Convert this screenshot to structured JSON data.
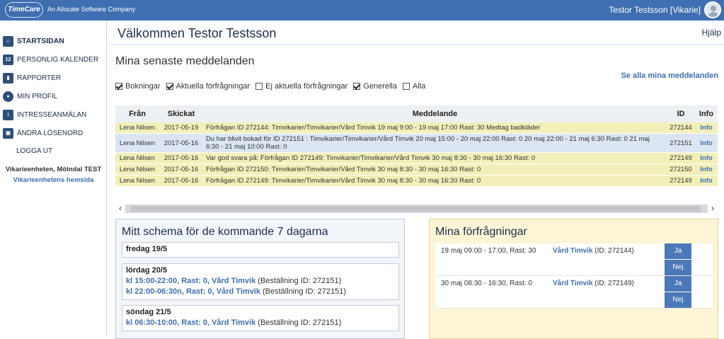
{
  "header": {
    "logo_text": "TimeCare",
    "company": "An Allocate Software Company",
    "user": "Testor Testsson [Vikarie]"
  },
  "sidebar": {
    "items": [
      {
        "label": "Startsidan",
        "icon": "home-icon"
      },
      {
        "label": "Personlig kalender",
        "icon": "calendar-icon",
        "icon_text": "12"
      },
      {
        "label": "Rapporter",
        "icon": "chart-icon"
      },
      {
        "label": "Min profil",
        "icon": "profile-icon"
      },
      {
        "label": "Intresseanmälan",
        "icon": "form-icon"
      },
      {
        "label": "Ändra lösenord",
        "icon": "lock-icon"
      }
    ],
    "logout": "LOGGA UT",
    "unit_name": "Vikarieenheten, Mölndal TEST",
    "unit_link": "Vikarieenhetens hemsida"
  },
  "main": {
    "title": "Välkommen Testor Testsson",
    "help": "Hjälp",
    "messages_title": "Mina senaste meddelanden",
    "see_all": "Se alla mina meddelanden",
    "filters": [
      {
        "label": "Bokningar",
        "checked": true
      },
      {
        "label": "Aktuella förfrågningar",
        "checked": true
      },
      {
        "label": "Ej aktuella förfrågningar",
        "checked": false
      },
      {
        "label": "Generella",
        "checked": true
      },
      {
        "label": "Alla",
        "checked": false
      }
    ],
    "table": {
      "headers": [
        "Från",
        "Skickat",
        "Meddelande",
        "ID",
        "Info"
      ],
      "rows": [
        {
          "from": "Lena Nilsen",
          "sent": "2017-05-19",
          "message": "Förfrågan ID 272144: Timvikarier/Timvikarier/Vård Timvik 19 maj 9:00 - 19 maj 17:00 Rast: 30 Medtag badkläder",
          "id": "272144",
          "info": "Info",
          "color": "y"
        },
        {
          "from": "Lena Nilsen",
          "sent": "2017-05-16",
          "message": "Du har blivit bokad för ID 272151 : Timvikarier/Timvikarier/Vård Timvik 20 maj 15:00 - 20 maj 22:00 Rast: 0 20 maj 22:00 - 21 maj 6:30 Rast: 0 21 maj 6:30 - 21 maj 10:00 Rast: 0",
          "id": "272151",
          "info": "Info",
          "color": "b"
        },
        {
          "from": "Lena Nilsen",
          "sent": "2017-05-16",
          "message": "Var god svara på: Förfrågan ID 272149: Timvikarier/Timvikarier/Vård Timvik 30 maj 8:30 - 30 maj 16:30 Rast: 0",
          "id": "272149",
          "info": "Info",
          "color": "y"
        },
        {
          "from": "Lena Nilsen",
          "sent": "2017-05-16",
          "message": "Förfrågan ID 272150: Timvikarier/Timvikarier/Vård Timvik 30 maj 8:30 - 30 maj 16:30 Rast: 0",
          "id": "272150",
          "info": "Info",
          "color": "y"
        },
        {
          "from": "Lena Nilsen",
          "sent": "2017-05-16",
          "message": "Förfrågan ID 272149: Timvikarier/Timvikarier/Vård Timvik 30 maj 8:30 - 30 maj 16:30 Rast: 0",
          "id": "272149",
          "info": "Info",
          "color": "y"
        }
      ]
    },
    "schema": {
      "title": "Mitt schema för de kommande 7 dagarna",
      "days": [
        {
          "title": "fredag 19/5",
          "shifts": []
        },
        {
          "title": "lördag 20/5",
          "shifts": [
            {
              "text": "kl 15:00-22:00, Rast: 0, Vård Timvik",
              "ref": " (Beställning ID: 272151)"
            },
            {
              "text": "kl 22:00-06:30n, Rast: 0, Vård Timvik",
              "ref": " (Beställning ID: 272151)"
            }
          ]
        },
        {
          "title": "söndag 21/5",
          "shifts": [
            {
              "text": "kl 06:30-10:00, Rast: 0, Vård Timvik",
              "ref": " (Beställning ID: 272151)"
            }
          ]
        }
      ]
    },
    "requests": {
      "title": "Mina förfrågningar",
      "items": [
        {
          "when": "19 maj 09:00 - 17:00, Rast: 30",
          "unit": "Vård Timvik",
          "id_text": " (ID: 272144)",
          "yes": "Ja",
          "no": "Nej"
        },
        {
          "when": "30 maj 08:30 - 16:30, Rast: 0",
          "unit": "Vård Timvik",
          "id_text": " (ID: 272149)",
          "yes": "Ja",
          "no": "Nej"
        }
      ]
    }
  }
}
